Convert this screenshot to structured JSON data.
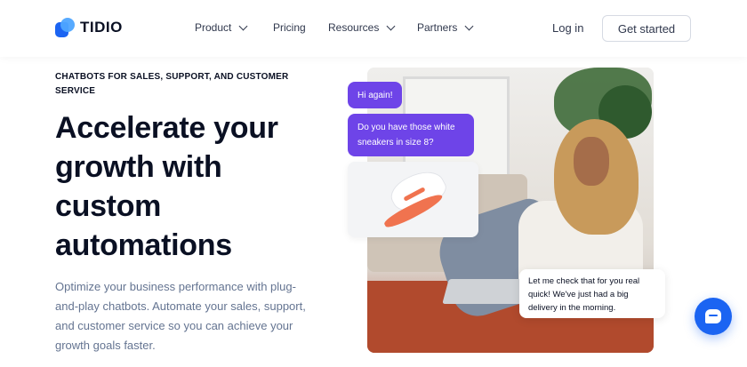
{
  "brand": {
    "name": "TIDIO",
    "accent": "#1b64f2",
    "logo_icon": "tidio-logo-icon"
  },
  "nav": {
    "items": [
      {
        "label": "Product",
        "has_dropdown": true
      },
      {
        "label": "Pricing",
        "has_dropdown": false
      },
      {
        "label": "Resources",
        "has_dropdown": true
      },
      {
        "label": "Partners",
        "has_dropdown": true
      }
    ],
    "login_label": "Log in",
    "cta_label": "Get started"
  },
  "hero": {
    "eyebrow": "CHATBOTS FOR SALES, SUPPORT, AND CUSTOMER SERVICE",
    "headline": "Accelerate your growth with custom automations",
    "subtext": "Optimize your business performance with plug-and-play chatbots. Automate your sales, support, and customer service so you can achieve your growth goals faster."
  },
  "chat_preview": {
    "bubble_1": "Hi again!",
    "bubble_2": "Do you have those white sneakers in size 8?",
    "reply": "Let me check that for you real quick! We've just had a big delivery in the morning.",
    "bubble_color": "#6e44e8"
  },
  "widget": {
    "icon": "chat-bubble-icon"
  }
}
